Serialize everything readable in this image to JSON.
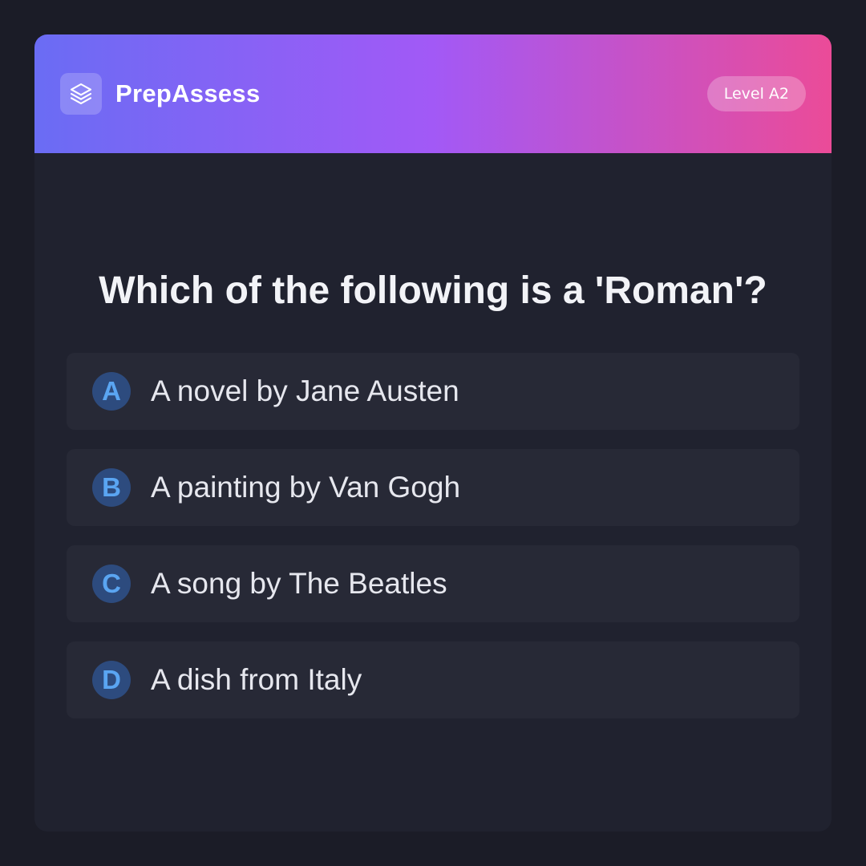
{
  "app": {
    "name": "PrepAssess",
    "level_badge": "Level A2",
    "logo_icon": "layers-icon"
  },
  "colors": {
    "background": "#1b1c27",
    "card": "#20222f",
    "option_bg": "#272936",
    "header_gradient": [
      "#6a6cf4",
      "#a259f6",
      "#eb4b98"
    ],
    "letter_bg": "#2d4b7e",
    "letter_fg": "#5aa5f2"
  },
  "question": {
    "text": "Which of the following is a 'Roman'?"
  },
  "options": [
    {
      "letter": "A",
      "text": "A novel by Jane Austen"
    },
    {
      "letter": "B",
      "text": "A painting by Van Gogh"
    },
    {
      "letter": "C",
      "text": "A song by The Beatles"
    },
    {
      "letter": "D",
      "text": "A dish from Italy"
    }
  ]
}
